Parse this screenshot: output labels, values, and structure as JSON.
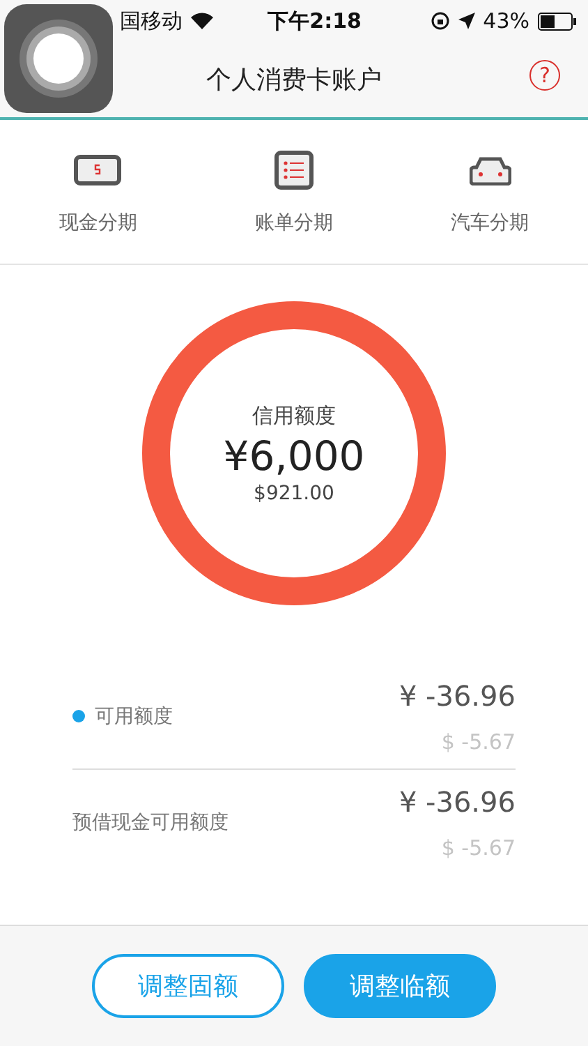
{
  "status_bar": {
    "carrier": "国移动",
    "time": "下午2:18",
    "battery": "43%"
  },
  "nav": {
    "title": "个人消费卡账户",
    "help": "?"
  },
  "shortcuts": [
    {
      "kind": "cash",
      "label": "现金分期"
    },
    {
      "kind": "bill",
      "label": "账单分期"
    },
    {
      "kind": "car",
      "label": "汽车分期"
    }
  ],
  "credit": {
    "label": "信用额度",
    "amount": "¥6,000",
    "usd": "$921.00"
  },
  "balances": [
    {
      "label": "可用额度",
      "color": "#1aa3e8",
      "cny": "¥ -36.96",
      "usd": "$ -5.67"
    },
    {
      "label": "预借现金可用额度",
      "cny": "¥ -36.96",
      "usd": "$ -5.67"
    }
  ],
  "buttons": [
    {
      "kind": "outline",
      "label": "调整固额"
    },
    {
      "kind": "filled",
      "label": "调整临额"
    }
  ]
}
